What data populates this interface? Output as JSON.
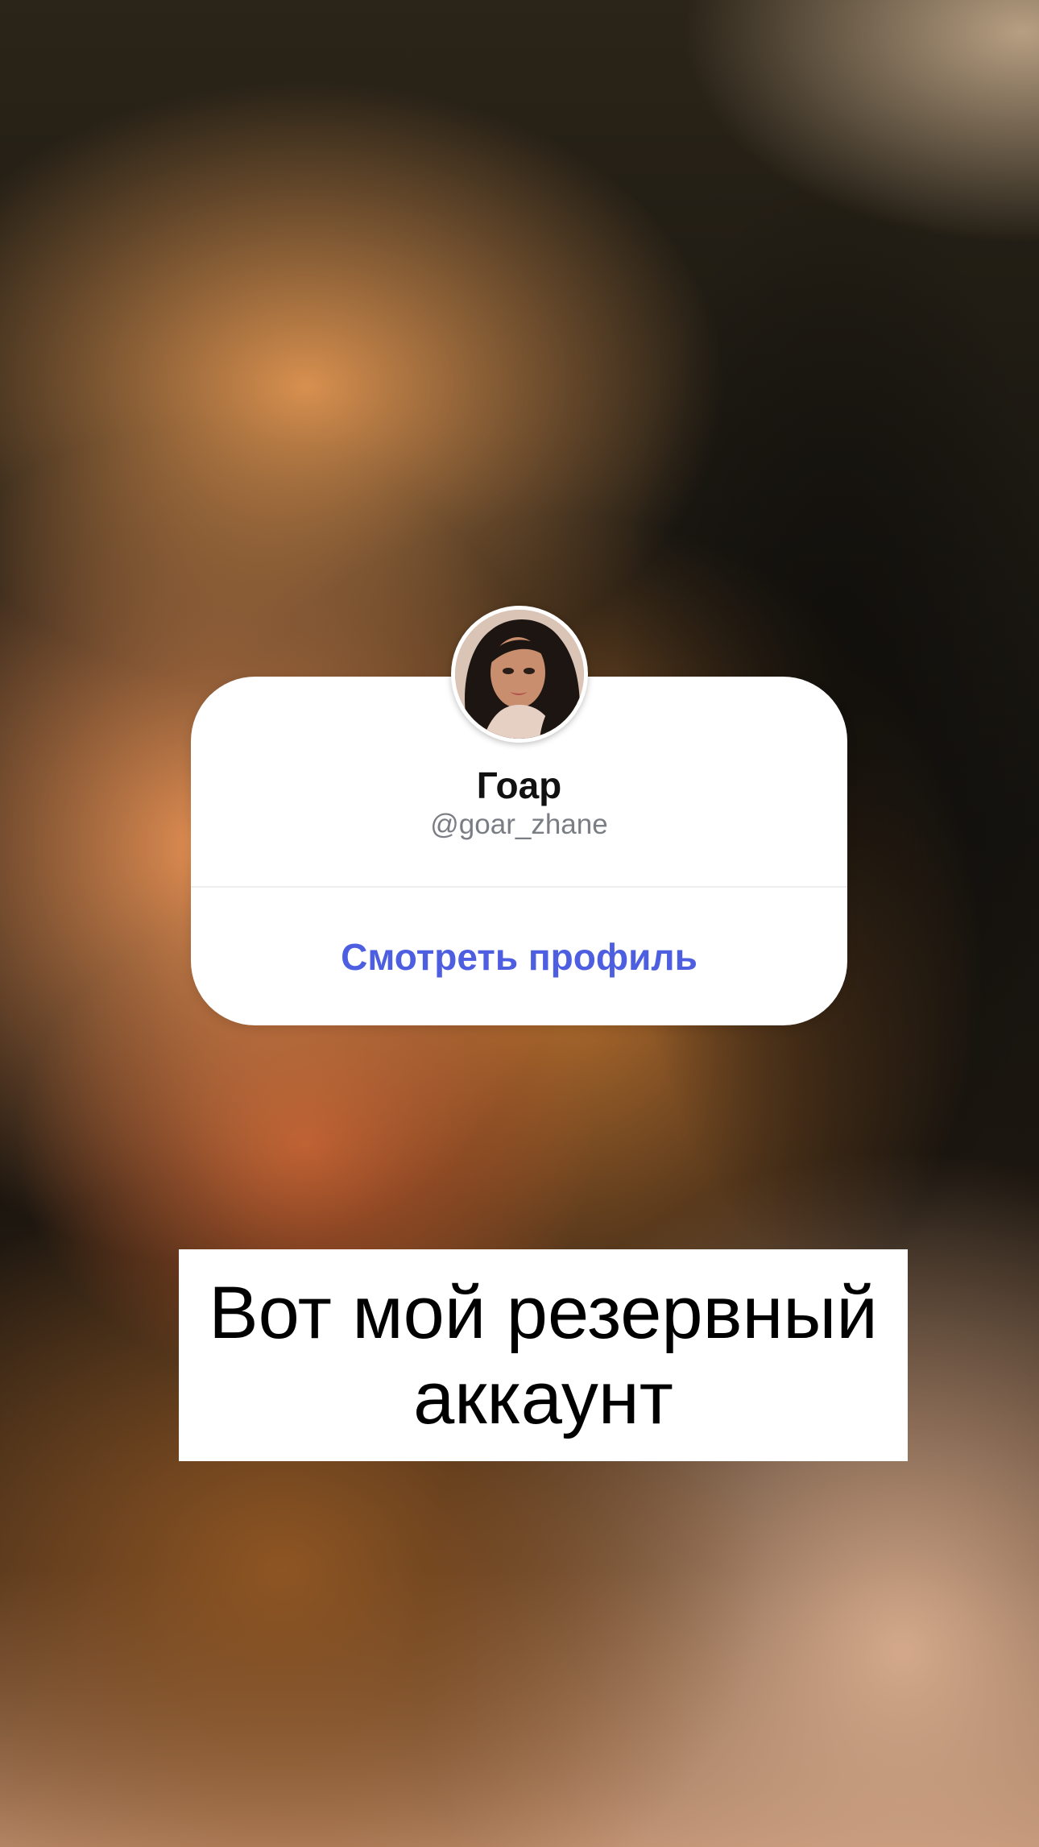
{
  "story": {
    "mention_sticker": {
      "name": "Гоар",
      "handle": "@goar_zhane",
      "action_label": "Смотреть профиль",
      "accent_color": "#4d5fe0"
    },
    "caption": {
      "text": "Вот мой резервный аккаунт"
    },
    "icons": {
      "avatar": "profile-photo"
    }
  }
}
